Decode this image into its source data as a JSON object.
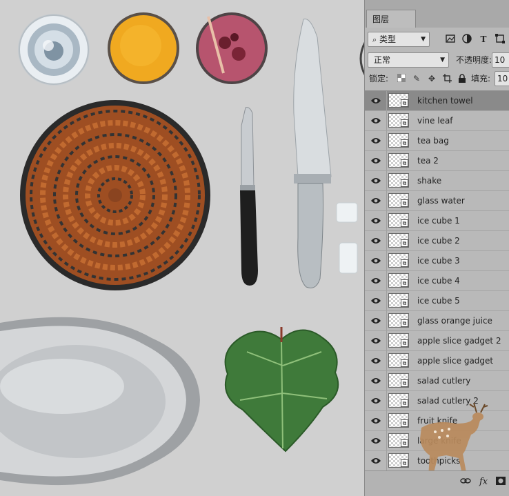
{
  "panel": {
    "tab_label": "图层",
    "filter": {
      "label": "类型",
      "icons": [
        "image-filter-icon",
        "adjust-filter-icon",
        "type-filter-icon",
        "shape-filter-icon"
      ]
    },
    "blend_mode": "正常",
    "opacity": {
      "label": "不透明度:",
      "value": "10"
    },
    "lock": {
      "label": "锁定:",
      "icons": [
        "lock-transparent-icon",
        "lock-paint-icon",
        "lock-move-icon",
        "lock-artboard-icon",
        "lock-all-icon"
      ]
    },
    "fill": {
      "label": "填充:",
      "value": "10"
    },
    "type_icon_text": "T",
    "footer_icons": [
      "link-icon",
      "fx-icon",
      "mask-icon"
    ],
    "fx_label": "fx"
  },
  "layers": [
    {
      "name": "kitchen towel",
      "selected": true
    },
    {
      "name": "vine leaf"
    },
    {
      "name": "tea bag"
    },
    {
      "name": "tea 2"
    },
    {
      "name": "shake"
    },
    {
      "name": "glass water"
    },
    {
      "name": "ice cube 1"
    },
    {
      "name": "ice cube 2"
    },
    {
      "name": "ice cube 3"
    },
    {
      "name": "ice cube 4"
    },
    {
      "name": "ice cube 5"
    },
    {
      "name": "glass orange juice"
    },
    {
      "name": "apple slice gadget 2"
    },
    {
      "name": "apple slice gadget"
    },
    {
      "name": "salad cutlery"
    },
    {
      "name": "salad cutlery 2"
    },
    {
      "name": "fruit knife"
    },
    {
      "name": "large knife"
    },
    {
      "name": "toothpicks"
    }
  ],
  "colors": {
    "canvas": "#d0d0d0",
    "panel": "#b9b9b9",
    "selected_row": "#8a8a8a"
  }
}
